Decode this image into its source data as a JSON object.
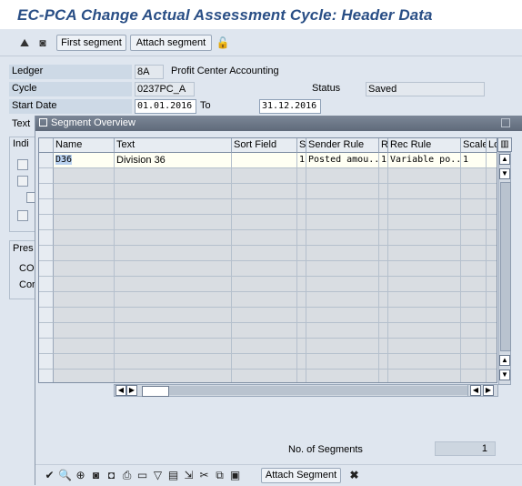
{
  "window": {
    "title": "EC-PCA Change Actual Assessment Cycle: Header Data"
  },
  "toolbar": {
    "first_segment": "First segment",
    "attach_segment": "Attach segment"
  },
  "header": {
    "ledger_label": "Ledger",
    "ledger_value": "8A",
    "ledger_desc": "Profit Center Accounting",
    "cycle_label": "Cycle",
    "cycle_value": "0237PC_A",
    "status_label": "Status",
    "status_value": "Saved",
    "start_date_label": "Start Date",
    "start_date_value": "01.01.2016",
    "to_label": "To",
    "to_value": "31.12.2016",
    "text_label": "Text"
  },
  "left_fragments": {
    "indi": "Indi",
    "pres": "Pres",
    "co": "CO",
    "cor": "Cor"
  },
  "dialog": {
    "title": "Segment Overview",
    "columns": [
      "Name",
      "Text",
      "Sort Field",
      "S",
      "Sender Rule",
      "R",
      "Rec Rule",
      "Scale",
      "Lo"
    ],
    "rows": [
      [
        "D36",
        "Division 36",
        "",
        "1",
        "Posted amou..",
        "1",
        "Variable po..",
        "1",
        ""
      ]
    ],
    "no_segments_label": "No. of Segments",
    "no_segments_value": "1",
    "attach_segment_button": "Attach Segment"
  },
  "colors": {
    "title": "#2a4f86",
    "background": "#dfe6ef",
    "dialog_title": "#6a7585"
  }
}
